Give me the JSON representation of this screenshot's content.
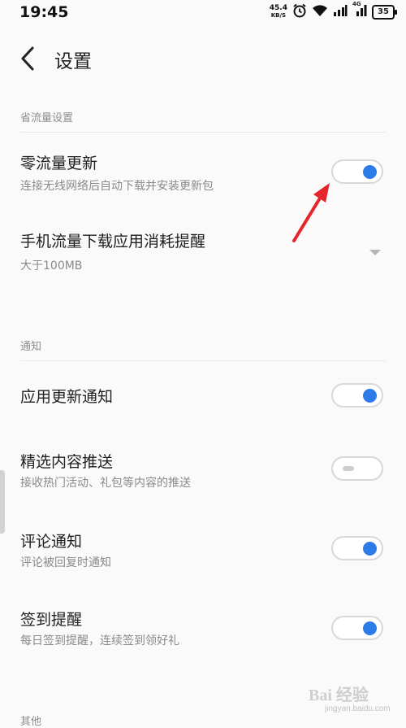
{
  "status_bar": {
    "time": "19:45",
    "net_speed_value": "45.4",
    "net_speed_unit": "KB/S",
    "signal1_label": "4G",
    "signal2_label": "4G",
    "battery": "35"
  },
  "header": {
    "back_icon": "chevron-left-icon",
    "title": "设置"
  },
  "sections": {
    "data_saving": {
      "label": "省流量设置",
      "zero_data_update": {
        "title": "零流量更新",
        "subtitle": "连接无线网络后自动下载并安装更新包",
        "enabled": true
      },
      "mobile_data_alert": {
        "title": "手机流量下载应用消耗提醒",
        "value": "大于100MB"
      }
    },
    "notifications": {
      "label": "通知",
      "app_update_notice": {
        "title": "应用更新通知",
        "enabled": true
      },
      "featured_push": {
        "title": "精选内容推送",
        "subtitle": "接收热门活动、礼包等内容的推送",
        "enabled": false
      },
      "comment_notice": {
        "title": "评论通知",
        "subtitle": "评论被回复时通知",
        "enabled": true
      },
      "checkin_reminder": {
        "title": "签到提醒",
        "subtitle": "每日签到提醒，连续签到领好礼",
        "enabled": true
      }
    },
    "other": {
      "label": "其他"
    }
  },
  "colors": {
    "accent": "#2d7be8",
    "annotation_arrow": "#e5262a"
  },
  "watermark": {
    "text": "Bai 经验",
    "url": "jingyan.baidu.com"
  }
}
